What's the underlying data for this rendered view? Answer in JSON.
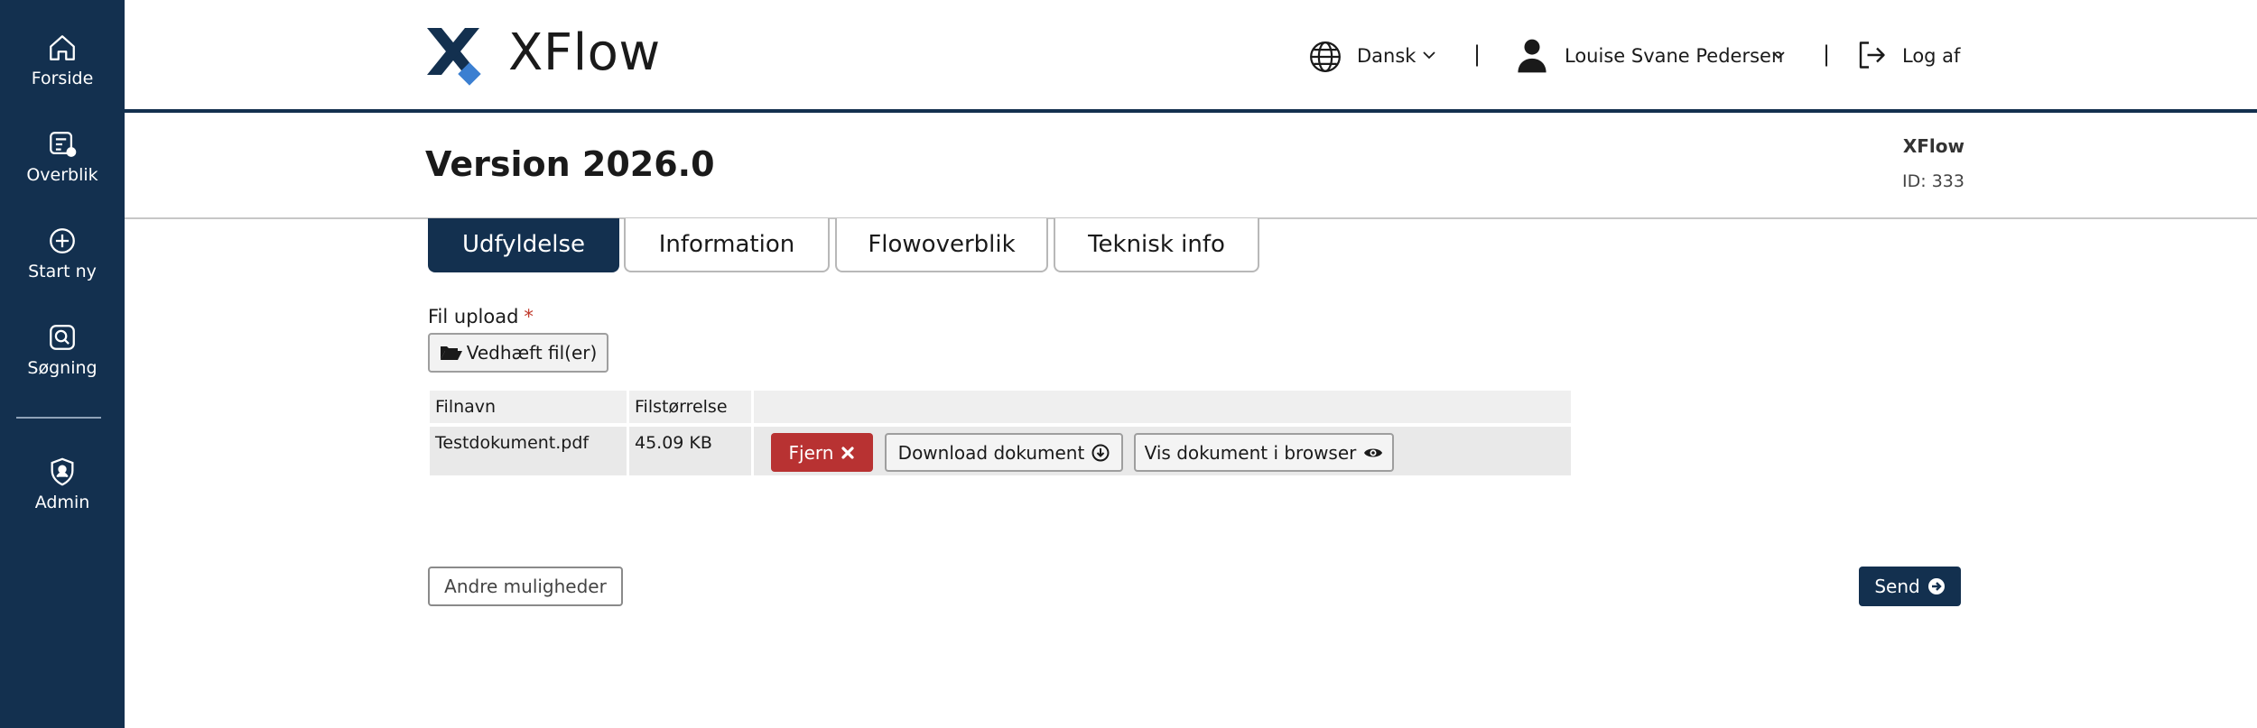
{
  "sidebar": {
    "items": [
      {
        "label": "Forside",
        "icon": "home-icon"
      },
      {
        "label": "Overblik",
        "icon": "overview-list-icon"
      },
      {
        "label": "Start ny",
        "icon": "plus-circle-icon"
      },
      {
        "label": "Søgning",
        "icon": "search-icon"
      },
      {
        "label": "Admin",
        "icon": "shield-user-icon"
      }
    ]
  },
  "header": {
    "logo_text": "XFlow",
    "language": "Dansk",
    "separator": "|",
    "user_name": "Louise Svane Pedersen",
    "logout": "Log af"
  },
  "page": {
    "title": "Version 2026.0",
    "app_name": "XFlow",
    "id_text": "ID: 333"
  },
  "tabs": [
    {
      "label": "Udfyldelse",
      "active": true
    },
    {
      "label": "Information",
      "active": false
    },
    {
      "label": "Flowoverblik",
      "active": false
    },
    {
      "label": "Teknisk info",
      "active": false
    }
  ],
  "form": {
    "file_label": "Fil upload",
    "required_marker": "*",
    "attach_button": "Vedhæft fil(er)"
  },
  "file_table": {
    "columns": [
      "Filnavn",
      "Filstørrelse",
      ""
    ],
    "rows": [
      {
        "name": "Testdokument.pdf",
        "size": "45.09 KB"
      }
    ],
    "actions": {
      "remove": "Fjern",
      "download": "Download dokument",
      "view": "Vis dokument i browser"
    }
  },
  "footer_actions": {
    "other": "Andre muligheder",
    "send": "Send"
  },
  "colors": {
    "primary": "#13304f",
    "danger": "#b83232",
    "logo_accent": "#3b7fd1"
  }
}
